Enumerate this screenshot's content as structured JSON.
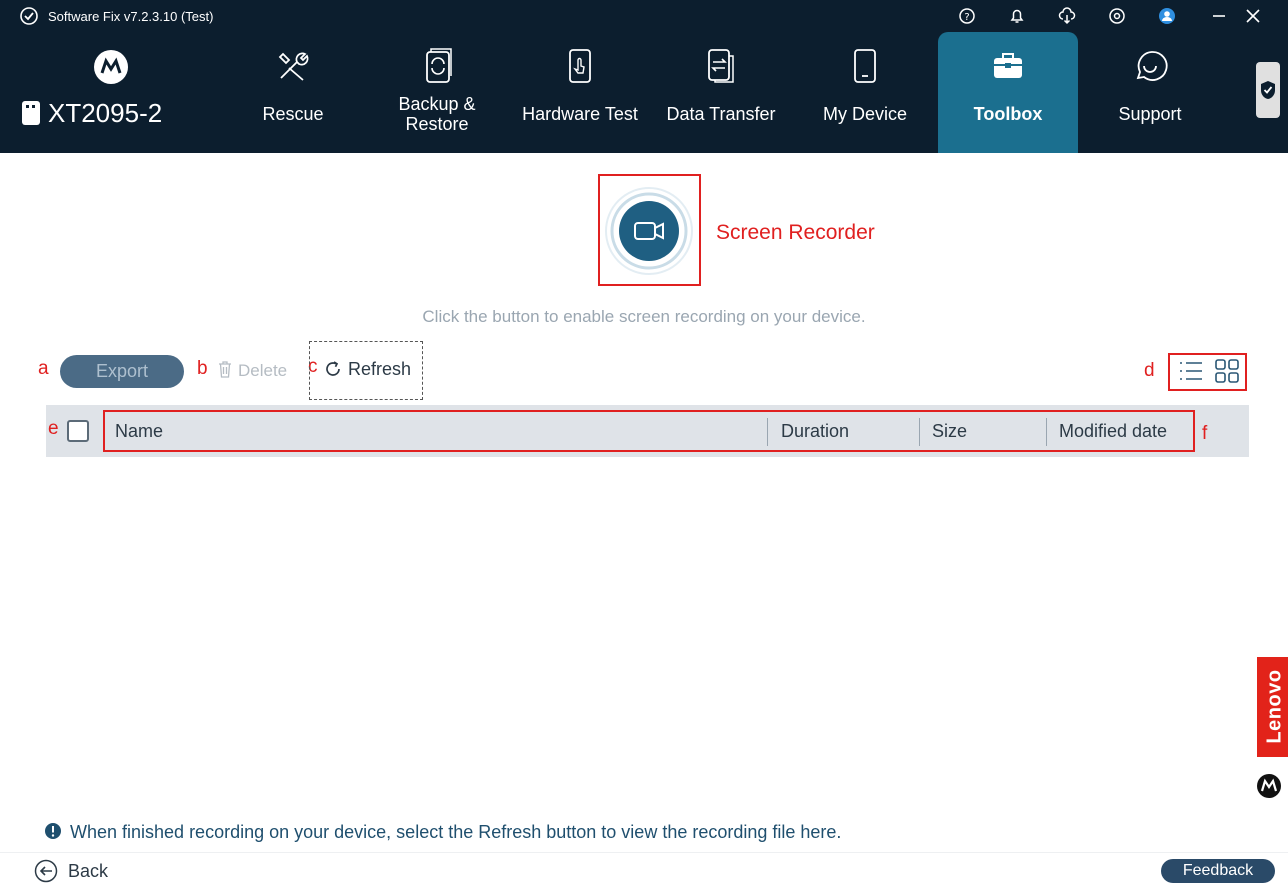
{
  "titlebar": {
    "title": "Software Fix v7.2.3.10 (Test)",
    "icons": [
      "help-icon",
      "bell-icon",
      "cloud-download-icon",
      "settings-icon",
      "user-icon",
      "minimize-icon",
      "close-icon"
    ]
  },
  "device": {
    "name": "XT2095-2"
  },
  "nav": [
    {
      "label": "Rescue",
      "icon": "tools-icon"
    },
    {
      "label": "Backup &\nRestore",
      "icon": "backup-restore-icon"
    },
    {
      "label": "Hardware Test",
      "icon": "hardware-test-icon"
    },
    {
      "label": "Data Transfer",
      "icon": "data-transfer-icon"
    },
    {
      "label": "My Device",
      "icon": "phone-icon"
    },
    {
      "label": "Toolbox",
      "icon": "toolbox-icon",
      "active": true
    },
    {
      "label": "Support",
      "icon": "chat-icon"
    }
  ],
  "recorder": {
    "label": "Screen Recorder",
    "hint": "Click the button to enable screen recording on your device."
  },
  "annotations": {
    "a": "a",
    "b": "b",
    "c": "c",
    "d": "d",
    "e": "e",
    "f": "f"
  },
  "toolbar": {
    "export_label": "Export",
    "delete_label": "Delete",
    "refresh_label": "Refresh"
  },
  "table": {
    "columns": [
      "Name",
      "Duration",
      "Size",
      "Modified date"
    ]
  },
  "side": {
    "lenovo_label": "Lenovo"
  },
  "footer": {
    "info": "When finished recording on your device, select the Refresh button to view the recording file here.",
    "back_label": "Back",
    "feedback_label": "Feedback"
  },
  "colors": {
    "header_bg": "#0c1e2e",
    "active_tab": "#1b6f8f",
    "accent_red": "#e02020",
    "lenovo_red": "#e2231a"
  }
}
